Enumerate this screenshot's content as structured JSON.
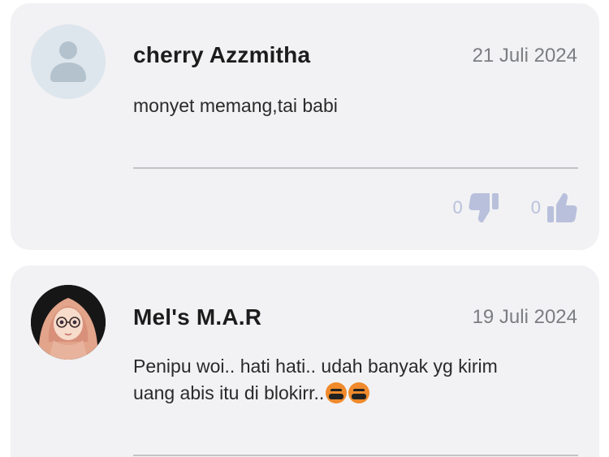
{
  "comments": [
    {
      "author": "cherry Azzmitha",
      "date": "21 Juli 2024",
      "text": "monyet memang,tai babi",
      "avatar": "default-user-icon",
      "dislikes": "0",
      "likes": "0"
    },
    {
      "author": "Mel's M.A.R",
      "date": "19 Juli 2024",
      "text_line1": "Penipu woi.. hati hati.. udah banyak yg kirim",
      "text_line2": "uang abis itu di blokirr..",
      "emojis": [
        "cursing-face-emoji",
        "cursing-face-emoji"
      ],
      "avatar": "hijab-girl-cartoon-avatar"
    }
  ],
  "colors": {
    "card_bg": "#f2f2f4",
    "name": "#1c1c1c",
    "date": "#7b7d80",
    "reaction": "#b9c0dc",
    "divider": "#c2c3c6"
  }
}
